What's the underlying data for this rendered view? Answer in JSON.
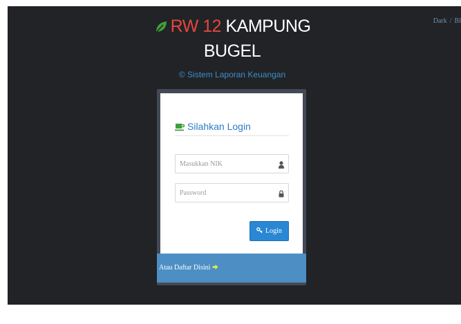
{
  "theme_switch": {
    "dark_label": "Dark",
    "separator": "/",
    "blue_label": "Bl"
  },
  "brand": {
    "title_red": "RW 12",
    "title_white": "KAMPUNG",
    "title_line2": "BUGEL",
    "subtitle": "© Sistem Laporan Keuangan"
  },
  "login_card": {
    "title": "Silahkan Login",
    "nik_placeholder": "Masukkan NIK",
    "password_placeholder": "Password",
    "login_button": "Login",
    "register_link": "Atau Daftar Disini"
  },
  "colors": {
    "background": "#212326",
    "brand_red": "#e8463c",
    "leaf_green": "#3fa03a",
    "accent_blue": "#2a87d3",
    "footer_blue": "#4d8fc4"
  },
  "icons": [
    "leaf-icon",
    "coffee-icon",
    "user-icon",
    "lock-icon",
    "key-icon",
    "arrow-right-icon"
  ]
}
